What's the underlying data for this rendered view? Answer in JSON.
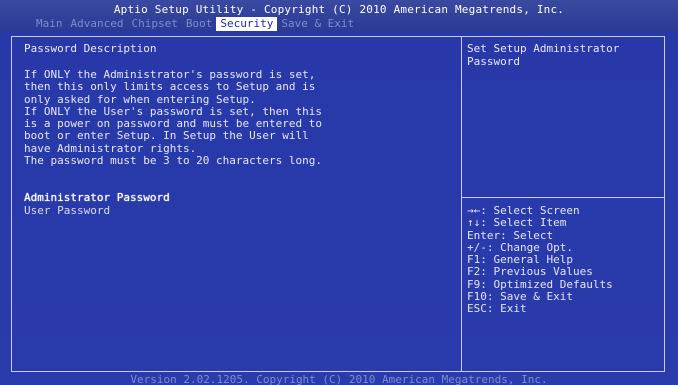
{
  "title": "Aptio Setup Utility - Copyright (C) 2010 American Megatrends, Inc.",
  "menu": {
    "tabs": [
      {
        "label": "Main"
      },
      {
        "label": "Advanced"
      },
      {
        "label": "Chipset"
      },
      {
        "label": "Boot"
      },
      {
        "label": "Security"
      },
      {
        "label": "Save & Exit"
      }
    ],
    "active_tab": "Security"
  },
  "description": {
    "heading": "Password Description",
    "lines": [
      "If ONLY the Administrator's password is set,",
      "then this only limits access to Setup and is",
      "only asked for when entering Setup.",
      "If ONLY the User's password is set, then this",
      "is a power on password and must be entered to",
      "boot or enter Setup. In Setup the User will",
      "have Administrator rights.",
      "The password must be 3 to 20 characters long."
    ]
  },
  "settings": {
    "items": [
      {
        "label": "Administrator Password"
      },
      {
        "label": "User Password"
      }
    ],
    "selected_index": 0
  },
  "help": {
    "lines": [
      "Set Setup Administrator",
      "Password"
    ]
  },
  "keys": {
    "lines": [
      "→←: Select Screen",
      "↑↓: Select Item",
      "Enter: Select",
      "+/-: Change Opt.",
      "F1: General Help",
      "F2: Previous Values",
      "F9: Optimized Defaults",
      "F10: Save & Exit",
      "ESC: Exit"
    ]
  },
  "footer": "Version 2.02.1205. Copyright (C) 2010 American Megatrends, Inc.",
  "colors": {
    "background": "#2a3bab",
    "text": "#e8e8f0",
    "inactive_tab": "#7c8cd0",
    "active_tab_bg": "#ffffff",
    "active_tab_text": "#1e2c9a"
  }
}
